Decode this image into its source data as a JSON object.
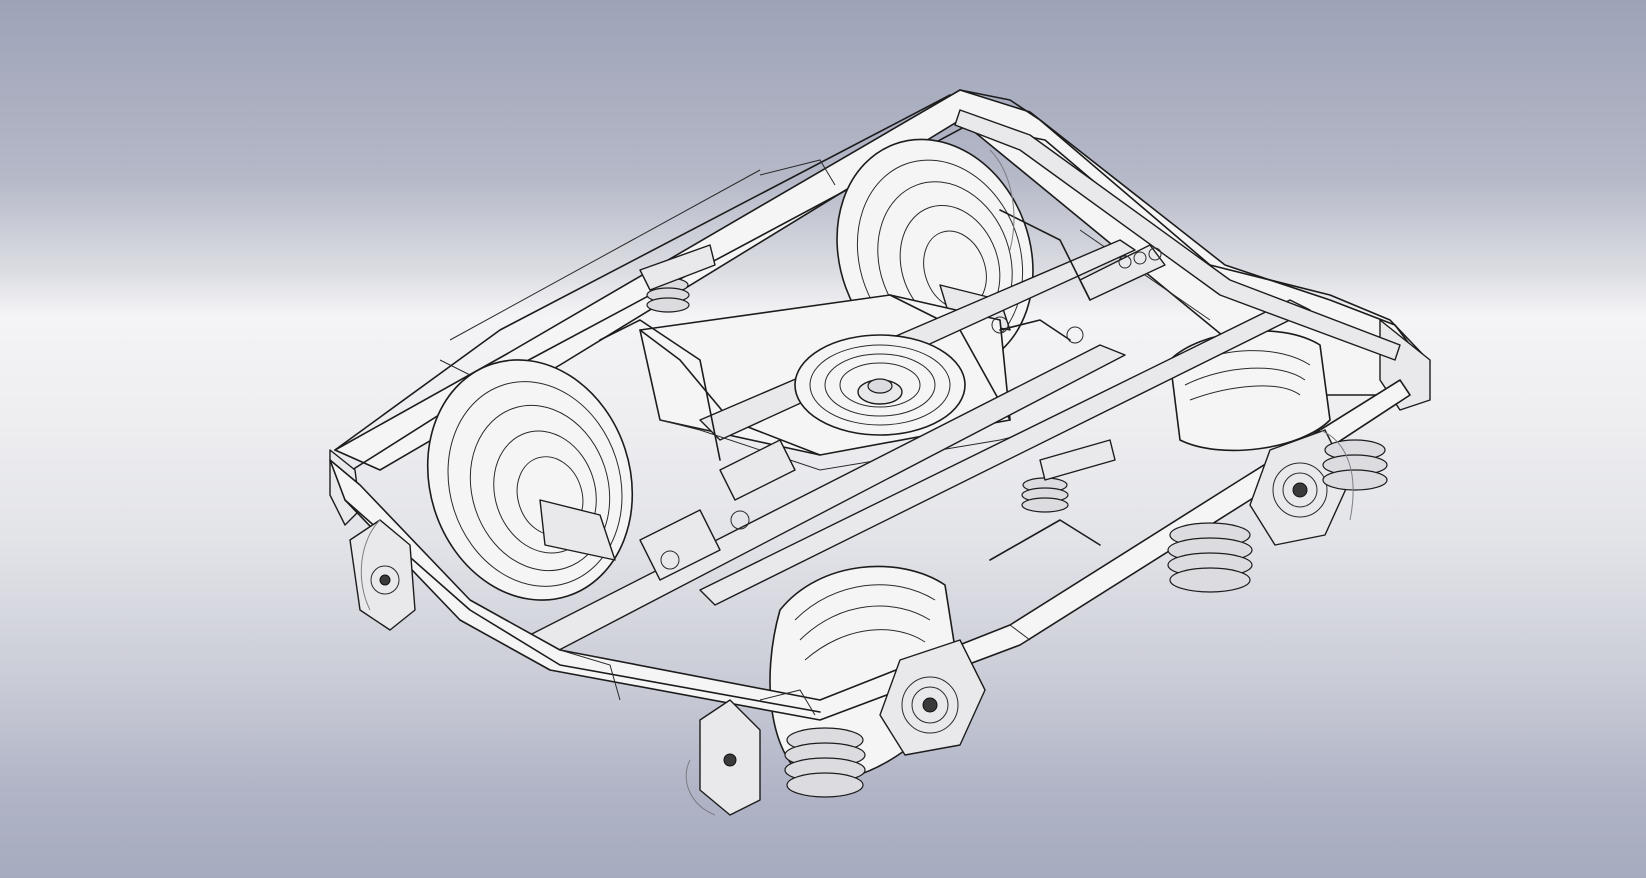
{
  "scene": {
    "type": "3d-cad-wireframe-view",
    "subject": "bogie-assembly",
    "render_style": "shaded-with-edges",
    "colors": {
      "background_top": "#9ea3b8",
      "background_mid": "#f4f4f6",
      "background_bottom": "#a7abbf",
      "edge_color": "#1c1c1c",
      "face_color": "#f5f5f5"
    }
  },
  "components": [
    {
      "id": "frame",
      "name": "bogie-frame"
    },
    {
      "id": "bolster",
      "name": "center-bolster"
    },
    {
      "id": "pivot",
      "name": "center-pivot-bowl"
    },
    {
      "id": "wheelset-rear",
      "name": "wheelset-rear"
    },
    {
      "id": "wheelset-front",
      "name": "wheelset-front"
    },
    {
      "id": "axlebox-front-left",
      "name": "axle-box-front-left"
    },
    {
      "id": "axlebox-front-right",
      "name": "axle-box-front-right"
    },
    {
      "id": "springs",
      "name": "coil-spring-sets"
    },
    {
      "id": "links",
      "name": "traction-rods-and-dampers"
    }
  ]
}
